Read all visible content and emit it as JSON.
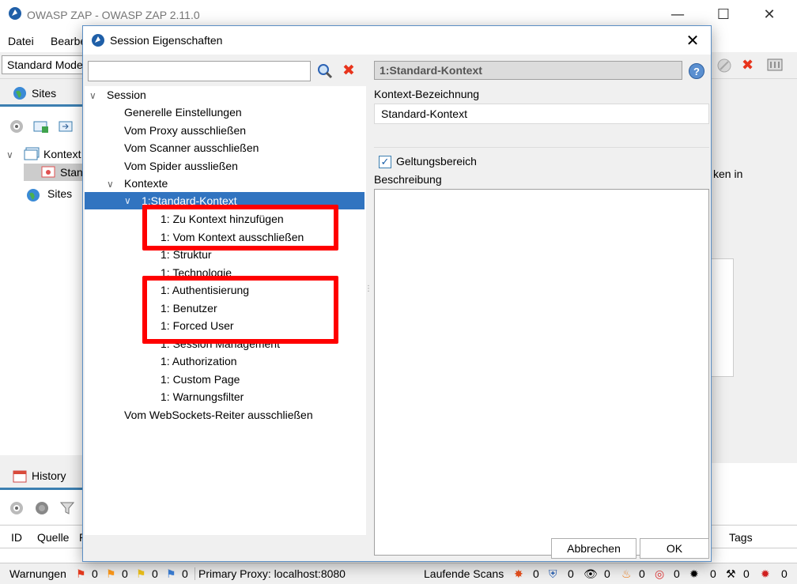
{
  "main": {
    "title": "OWASP ZAP - OWASP ZAP 2.11.0",
    "menu": [
      "Datei",
      "Bearbe"
    ],
    "mode": "Standard Mode",
    "sites_tab": "Sites",
    "tree": [
      "Kontext",
      "Stan",
      "Sites"
    ],
    "partial_text": "ken in",
    "history_tab": "History",
    "history_columns": [
      "ID",
      "Quelle",
      "R",
      "Tags"
    ]
  },
  "dialog": {
    "title": "Session Eigenschaften",
    "search_value": "",
    "tree": [
      {
        "label": "Session",
        "toggle": "open"
      },
      {
        "label": "Generelle Einstellungen"
      },
      {
        "label": "Vom Proxy ausschließen"
      },
      {
        "label": "Vom Scanner ausschließen"
      },
      {
        "label": "Vom Spider aussließen"
      },
      {
        "label": "Kontexte",
        "toggle": "open"
      },
      {
        "label": "1:Standard-Kontext",
        "toggle": "open",
        "selected": true
      },
      {
        "label": "1: Zu Kontext hinzufügen"
      },
      {
        "label": "1: Vom Kontext ausschließen"
      },
      {
        "label": "1: Struktur"
      },
      {
        "label": "1: Technologie"
      },
      {
        "label": "1: Authentisierung"
      },
      {
        "label": "1: Benutzer"
      },
      {
        "label": "1: Forced User"
      },
      {
        "label": "1: Session Management"
      },
      {
        "label": "1: Authorization"
      },
      {
        "label": "1: Custom Page"
      },
      {
        "label": "1: Warnungsfilter"
      },
      {
        "label": "Vom WebSockets-Reiter ausschließen"
      }
    ],
    "context_header": "1:Standard-Kontext",
    "name_label": "Kontext-Bezeichnung",
    "name_value": "Standard-Kontext",
    "scope_label": "Geltungsbereich",
    "scope_checked": true,
    "description_label": "Beschreibung",
    "description_value": "",
    "cancel_label": "Abbrechen",
    "ok_label": "OK"
  },
  "statusbar": {
    "alerts_label": "Warnungen",
    "alert_counts": [
      "0",
      "0",
      "0",
      "0"
    ],
    "proxy": "Primary Proxy: localhost:8080",
    "scans_label": "Laufende Scans",
    "scan_counts": [
      "0",
      "0",
      "0",
      "0",
      "0",
      "0",
      "0",
      "0"
    ]
  },
  "colors": {
    "selection": "#3174c0",
    "highlight_box": "#ff0000",
    "accent": "#3c7fb1"
  }
}
